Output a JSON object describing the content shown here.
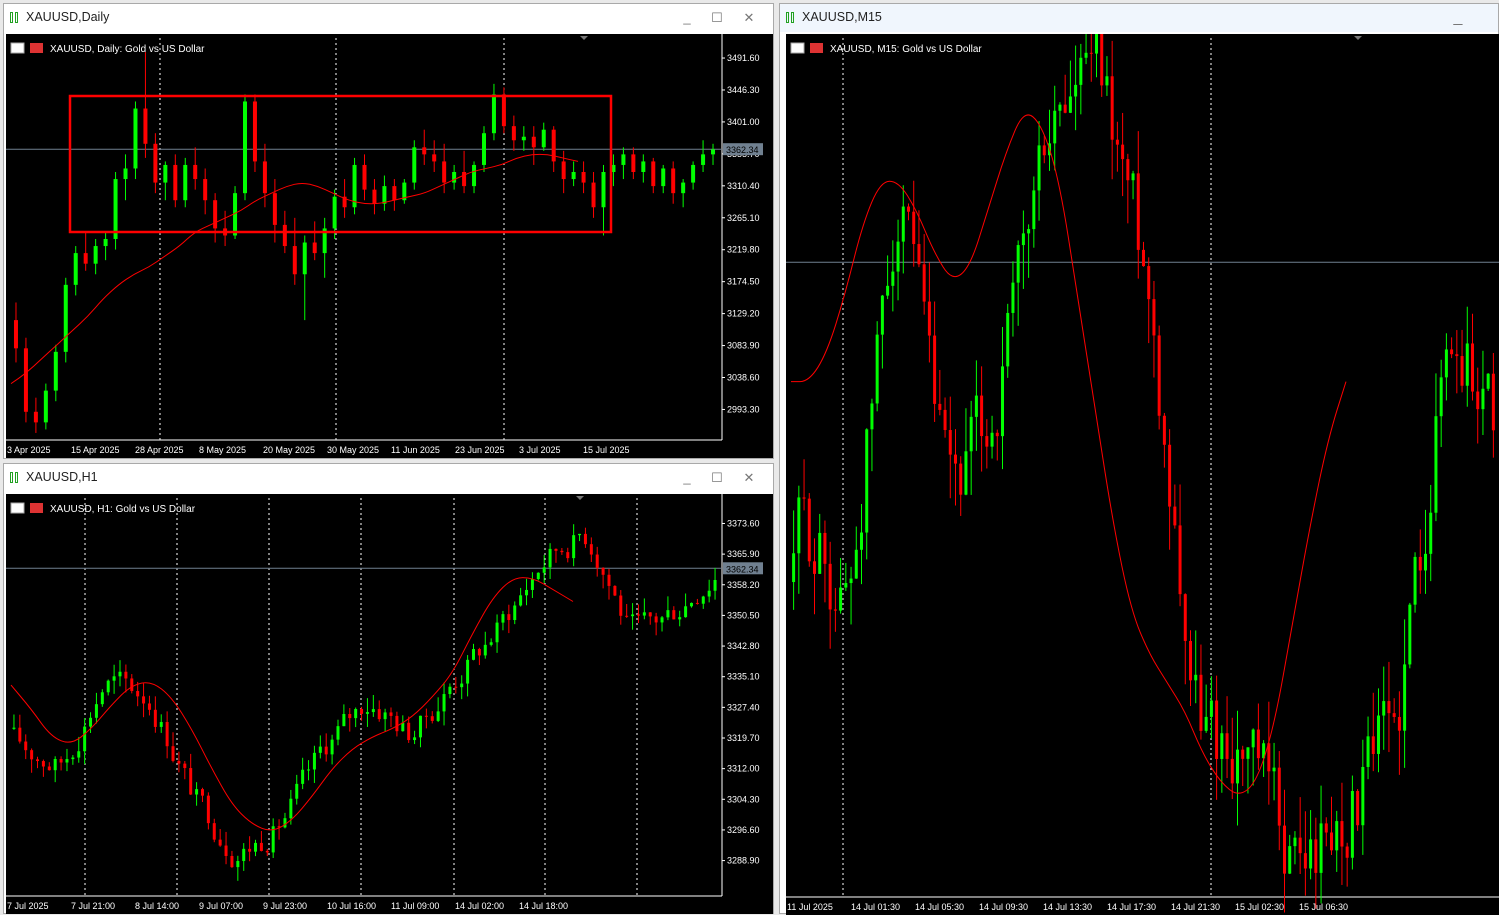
{
  "windows": [
    {
      "id": "daily",
      "title": "XAUUSD,Daily",
      "header": "XAUUSD, Daily:  Gold vs US Dollar",
      "current_price": "3362.34",
      "active": false,
      "chart_data": {
        "type": "candlestick",
        "symbol": "XAUUSD",
        "timeframe": "Daily",
        "ylim": [
          2950,
          3520
        ],
        "yticks": [
          "3491.60",
          "3446.30",
          "3401.00",
          "3355.70",
          "3310.40",
          "3265.10",
          "3219.80",
          "3174.50",
          "3129.20",
          "3083.90",
          "3038.60",
          "2993.30"
        ],
        "xticks": [
          "3 Apr 2025",
          "15 Apr 2025",
          "28 Apr 2025",
          "8 May 2025",
          "20 May 2025",
          "30 May 2025",
          "11 Jun 2025",
          "23 Jun 2025",
          "3 Jul 2025",
          "15 Jul 2025"
        ],
        "current_price": 3362.34,
        "ohlc": [
          [
            3120,
            3145,
            3060,
            3080
          ],
          [
            3080,
            3095,
            2975,
            2990
          ],
          [
            2990,
            3010,
            2960,
            2975
          ],
          [
            2975,
            3030,
            2965,
            3020
          ],
          [
            3020,
            3085,
            3005,
            3075
          ],
          [
            3075,
            3180,
            3060,
            3170
          ],
          [
            3170,
            3225,
            3155,
            3215
          ],
          [
            3215,
            3245,
            3190,
            3200
          ],
          [
            3200,
            3235,
            3185,
            3225
          ],
          [
            3225,
            3245,
            3205,
            3235
          ],
          [
            3235,
            3330,
            3220,
            3320
          ],
          [
            3320,
            3355,
            3290,
            3335
          ],
          [
            3335,
            3430,
            3320,
            3420
          ],
          [
            3420,
            3500,
            3350,
            3370
          ],
          [
            3370,
            3385,
            3300,
            3315
          ],
          [
            3315,
            3345,
            3290,
            3340
          ],
          [
            3340,
            3355,
            3280,
            3290
          ],
          [
            3290,
            3350,
            3280,
            3340
          ],
          [
            3340,
            3365,
            3305,
            3320
          ],
          [
            3320,
            3335,
            3270,
            3290
          ],
          [
            3290,
            3300,
            3230,
            3250
          ],
          [
            3250,
            3275,
            3225,
            3240
          ],
          [
            3240,
            3310,
            3235,
            3300
          ],
          [
            3300,
            3440,
            3290,
            3430
          ],
          [
            3430,
            3440,
            3330,
            3345
          ],
          [
            3345,
            3370,
            3280,
            3300
          ],
          [
            3300,
            3320,
            3230,
            3255
          ],
          [
            3255,
            3275,
            3215,
            3225
          ],
          [
            3225,
            3265,
            3170,
            3185
          ],
          [
            3185,
            3240,
            3120,
            3230
          ],
          [
            3230,
            3260,
            3205,
            3215
          ],
          [
            3215,
            3265,
            3180,
            3250
          ],
          [
            3250,
            3305,
            3235,
            3295
          ],
          [
            3295,
            3320,
            3265,
            3280
          ],
          [
            3280,
            3350,
            3270,
            3340
          ],
          [
            3340,
            3355,
            3290,
            3305
          ],
          [
            3305,
            3320,
            3270,
            3285
          ],
          [
            3285,
            3325,
            3275,
            3310
          ],
          [
            3310,
            3320,
            3275,
            3290
          ],
          [
            3290,
            3320,
            3285,
            3315
          ],
          [
            3315,
            3375,
            3305,
            3365
          ],
          [
            3365,
            3390,
            3340,
            3355
          ],
          [
            3355,
            3375,
            3330,
            3345
          ],
          [
            3345,
            3370,
            3300,
            3315
          ],
          [
            3315,
            3340,
            3305,
            3330
          ],
          [
            3330,
            3360,
            3300,
            3310
          ],
          [
            3310,
            3345,
            3300,
            3340
          ],
          [
            3340,
            3395,
            3330,
            3385
          ],
          [
            3385,
            3455,
            3375,
            3440
          ],
          [
            3440,
            3450,
            3385,
            3395
          ],
          [
            3395,
            3410,
            3360,
            3375
          ],
          [
            3375,
            3395,
            3360,
            3380
          ],
          [
            3380,
            3395,
            3340,
            3365
          ],
          [
            3365,
            3400,
            3360,
            3390
          ],
          [
            3390,
            3395,
            3330,
            3345
          ],
          [
            3345,
            3360,
            3300,
            3320
          ],
          [
            3320,
            3345,
            3310,
            3330
          ],
          [
            3330,
            3345,
            3300,
            3315
          ],
          [
            3315,
            3330,
            3265,
            3280
          ],
          [
            3280,
            3340,
            3240,
            3330
          ],
          [
            3330,
            3355,
            3310,
            3340
          ],
          [
            3340,
            3365,
            3320,
            3355
          ],
          [
            3355,
            3365,
            3320,
            3330
          ],
          [
            3330,
            3355,
            3315,
            3345
          ],
          [
            3345,
            3350,
            3300,
            3310
          ],
          [
            3310,
            3340,
            3300,
            3335
          ],
          [
            3335,
            3345,
            3285,
            3300
          ],
          [
            3300,
            3320,
            3280,
            3315
          ],
          [
            3315,
            3345,
            3305,
            3340
          ],
          [
            3340,
            3375,
            3330,
            3355
          ],
          [
            3355,
            3370,
            3340,
            3362
          ]
        ],
        "ma": [
          3030,
          3045,
          3065,
          3085,
          3105,
          3125,
          3150,
          3170,
          3185,
          3195,
          3210,
          3225,
          3245,
          3255,
          3265,
          3275,
          3290,
          3300,
          3310,
          3315,
          3310,
          3300,
          3290,
          3285,
          3285,
          3290,
          3295,
          3300,
          3310,
          3320,
          3330,
          3335,
          3340,
          3350,
          3355,
          3355,
          3350,
          3345
        ]
      }
    },
    {
      "id": "h1",
      "title": "XAUUSD,H1",
      "header": "XAUUSD, H1:  Gold vs US Dollar",
      "current_price": "3362.34",
      "active": false,
      "chart_data": {
        "type": "candlestick",
        "symbol": "XAUUSD",
        "timeframe": "H1",
        "ylim": [
          3280,
          3380
        ],
        "yticks": [
          "3373.60",
          "3365.90",
          "3358.20",
          "3350.50",
          "3342.80",
          "3335.10",
          "3327.40",
          "3319.70",
          "3312.00",
          "3304.30",
          "3296.60",
          "3288.90"
        ],
        "xticks": [
          "7 Jul 2025",
          "7 Jul 21:00",
          "8 Jul 14:00",
          "9 Jul 07:00",
          "9 Jul 23:00",
          "10 Jul 16:00",
          "11 Jul 09:00",
          "14 Jul 02:00",
          "14 Jul 18:00"
        ],
        "current_price": 3362.34,
        "ma": [
          3333,
          3327,
          3320,
          3318,
          3322,
          3328,
          3333,
          3334,
          3330,
          3322,
          3312,
          3303,
          3298,
          3296,
          3299,
          3305,
          3312,
          3317,
          3320,
          3322,
          3325,
          3330,
          3336,
          3346,
          3355,
          3360,
          3360,
          3357,
          3354
        ]
      }
    },
    {
      "id": "m15",
      "title": "XAUUSD,M15",
      "header": "XAUUSD, M15:  Gold vs US Dollar",
      "current_price": "3362.34",
      "active": true,
      "chart_data": {
        "type": "candlestick",
        "symbol": "XAUUSD",
        "timeframe": "M15",
        "ylim": [
          3318,
          3378
        ],
        "yticks": [],
        "xticks": [
          "11 Jul 2025",
          "14 Jul 01:30",
          "14 Jul 05:30",
          "14 Jul 09:30",
          "14 Jul 13:30",
          "14 Jul 17:30",
          "14 Jul 21:30",
          "15 Jul 02:30",
          "15 Jul 06:30"
        ],
        "current_price": 3362.34,
        "ma": [
          3354,
          3354,
          3356,
          3360,
          3365,
          3368,
          3368,
          3366,
          3363,
          3361,
          3362,
          3366,
          3370,
          3373,
          3372,
          3368,
          3360,
          3352,
          3344,
          3338,
          3335,
          3333,
          3331,
          3328,
          3326,
          3325,
          3326,
          3330,
          3337,
          3344,
          3350,
          3354
        ]
      }
    }
  ],
  "icons": {
    "window_icon": "candlestick-chart-icon",
    "minimize": "minimize-icon",
    "maximize": "maximize-icon",
    "close": "close-icon",
    "flag": "us-flag-icon"
  },
  "colors": {
    "bull": "#00ff00",
    "bear": "#ff0000",
    "ma": "#ff0000",
    "background": "#000000",
    "grid": "#ffffff",
    "axis_text": "#ffffff",
    "box": "#ff0000",
    "price_line": "#708090"
  }
}
